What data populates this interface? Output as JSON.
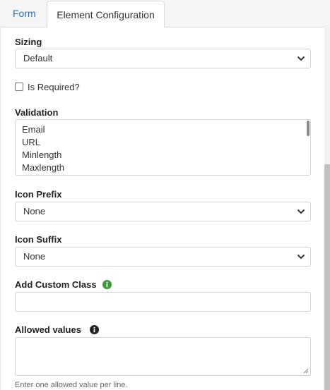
{
  "tabs": [
    {
      "label": "Form"
    },
    {
      "label": "Element Configuration"
    }
  ],
  "sizing": {
    "label": "Sizing",
    "value": "Default"
  },
  "required": {
    "label": "Is Required?",
    "checked": false
  },
  "validation": {
    "label": "Validation",
    "options": [
      "Email",
      "URL",
      "Minlength",
      "Maxlength"
    ]
  },
  "icon_prefix": {
    "label": "Icon Prefix",
    "value": "None"
  },
  "icon_suffix": {
    "label": "Icon Suffix",
    "value": "None"
  },
  "custom_class": {
    "label": "Add Custom Class",
    "value": "",
    "info_icon": "info-circle-green"
  },
  "allowed_values": {
    "label": "Allowed values",
    "value": "",
    "info_icon": "info-circle-dark",
    "help": "Enter one allowed value per line."
  },
  "colors": {
    "link": "#2a6ebb",
    "info_green": "#3a9b3a",
    "info_dark": "#222222"
  }
}
